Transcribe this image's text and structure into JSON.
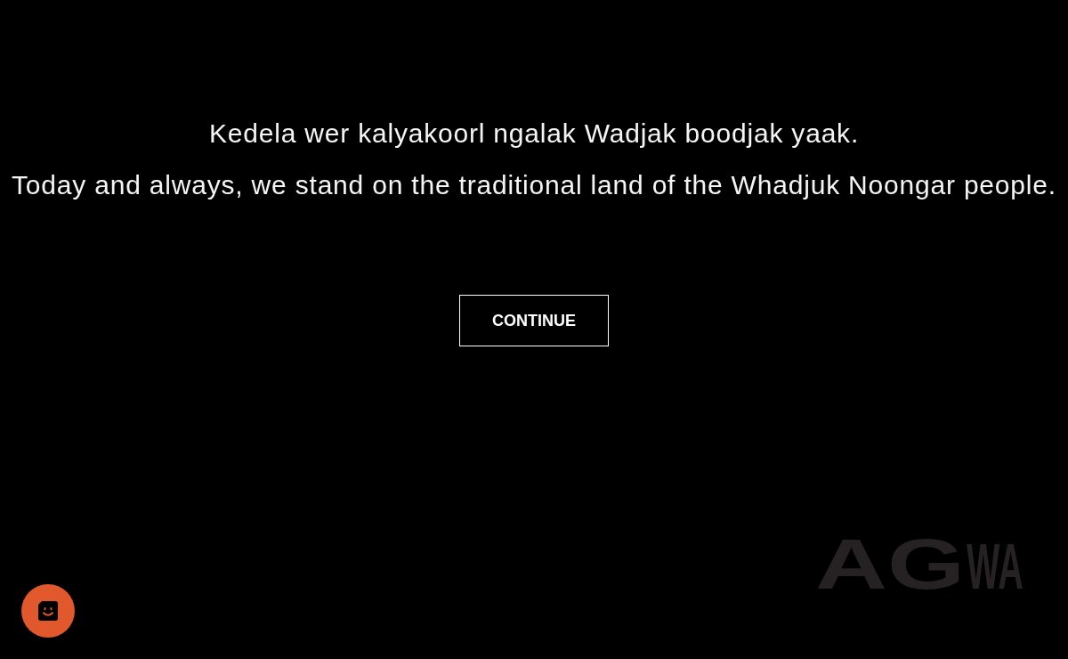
{
  "acknowledgement": {
    "lines": [
      "Kedela wer kalyakoorl ngalak Wadjak boodjak yaak.",
      "Today and always, we stand on the traditional land of the Whadjuk Noongar people."
    ]
  },
  "continue_button": {
    "label": "CONTINUE"
  },
  "logo": {
    "main": "AG",
    "suffix": "WA"
  }
}
